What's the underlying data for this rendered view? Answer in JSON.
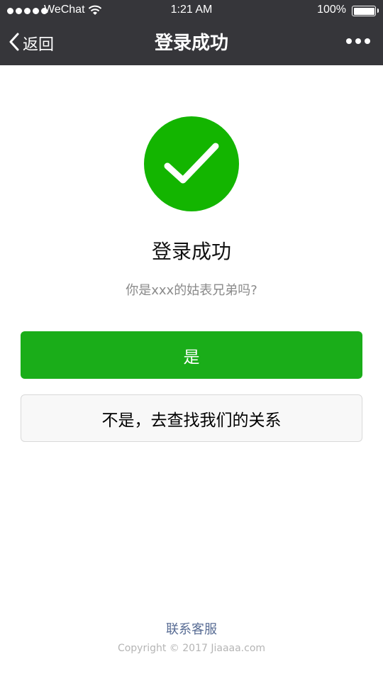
{
  "status_bar": {
    "carrier": "WeChat",
    "time": "1:21 AM",
    "battery": "100%"
  },
  "navbar": {
    "back_label": "返回",
    "title": "登录成功"
  },
  "result": {
    "icon": "success-check-icon",
    "title": "登录成功",
    "description": "你是xxx的姑表兄弟吗?"
  },
  "actions": {
    "primary_label": "是",
    "default_label": "不是，去查找我们的关系"
  },
  "footer": {
    "link": "联系客服",
    "copyright": "Copyright © 2017 Jiaaaa.com"
  },
  "colors": {
    "nav_bg": "#36363a",
    "success": "#13b500",
    "primary_button": "#1aad19",
    "link": "#586c94"
  }
}
